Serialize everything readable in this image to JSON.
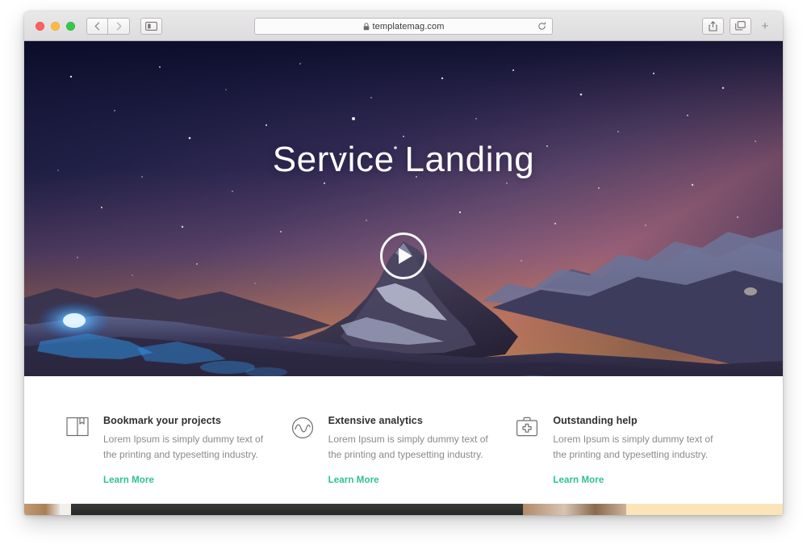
{
  "browser": {
    "traffic_lights": {
      "close_label": "close",
      "minimize_label": "minimize",
      "maximize_label": "maximize"
    },
    "back_label": "‹",
    "forward_label": "›",
    "sidebar_label": "Show Sidebar",
    "url": "templatemag.com",
    "lock_icon": "lock-icon",
    "reload_icon": "reload-icon",
    "share_icon": "share-icon",
    "tabs_icon": "show-tabs-icon",
    "new_tab_label": "+"
  },
  "hero": {
    "title": "Service Landing",
    "play_button_label": "Play video"
  },
  "features": [
    {
      "icon": "book-bookmark-icon",
      "title": "Bookmark your projects",
      "description": "Lorem Ipsum is simply dummy text of the printing and typesetting industry.",
      "link_label": "Learn More"
    },
    {
      "icon": "analytics-wave-icon",
      "title": "Extensive analytics",
      "description": "Lorem Ipsum is simply dummy text of the printing and typesetting industry.",
      "link_label": "Learn More"
    },
    {
      "icon": "first-aid-kit-icon",
      "title": "Outstanding help",
      "description": "Lorem Ipsum is simply dummy text of the printing and typesetting industry.",
      "link_label": "Learn More"
    }
  ],
  "colors": {
    "accent_green": "#2ec28b",
    "title_text": "#2f2f2f",
    "body_text": "#8a8a8a",
    "hero_dark": "#0d1030",
    "hero_sunset": "#f19d4a"
  }
}
